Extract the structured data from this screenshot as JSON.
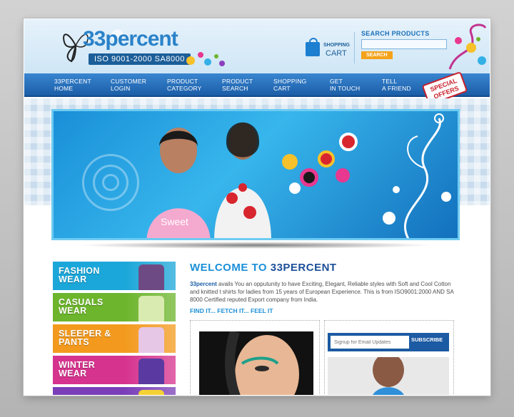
{
  "header": {
    "brand": "33percent",
    "certification": "ISO 9001-2000   SA8000",
    "cart": {
      "small": "SHOPPING",
      "big": "CART"
    },
    "search": {
      "label": "SEARCH PRODUCTS",
      "placeholder": "",
      "button": "SEARCH"
    }
  },
  "nav": {
    "items": [
      {
        "l1": "33PERCENT",
        "l2": "HOME"
      },
      {
        "l1": "CUSTOMER",
        "l2": "LOGIN"
      },
      {
        "l1": "PRODUCT",
        "l2": "CATEGORY"
      },
      {
        "l1": "PRODUCT",
        "l2": "SEARCH"
      },
      {
        "l1": "SHOPPING",
        "l2": "CART"
      },
      {
        "l1": "GET",
        "l2": "IN TOUCH"
      },
      {
        "l1": "TELL",
        "l2": "A FRIEND"
      }
    ],
    "special": {
      "l1": "SPECIAL",
      "l2": "OFFERS"
    }
  },
  "sidebar": {
    "categories": [
      {
        "l1": "FASHION",
        "l2": "WEAR",
        "color": "#1ba7d9"
      },
      {
        "l1": "CASUALS",
        "l2": "WEAR",
        "color": "#6db52d"
      },
      {
        "l1": "SLEEPER &",
        "l2": "PANTS",
        "color": "#f39a1e"
      },
      {
        "l1": "WINTER",
        "l2": "WEAR",
        "color": "#d6338e"
      },
      {
        "l1": "",
        "l2": "",
        "color": "#7a3fb8"
      }
    ]
  },
  "main": {
    "welcome_a": "WELCOME TO ",
    "welcome_b": "33PERCENT",
    "intro_bold": "33percent",
    "intro_rest": " avails You an opputunity to have Exciting, Elegant, Reliable styles with Soft and Cool Cotton and knitted t shirts for ladies from 15 years of European Experience. This is from ISO9001:2000 AND SA 8000 Certified reputed Export company from India.",
    "tagline": "FIND IT... FETCH IT... FEEL IT",
    "newsletter": {
      "placeholder": "Signup for Email Updates",
      "button": "SUBSCRIBE"
    }
  }
}
